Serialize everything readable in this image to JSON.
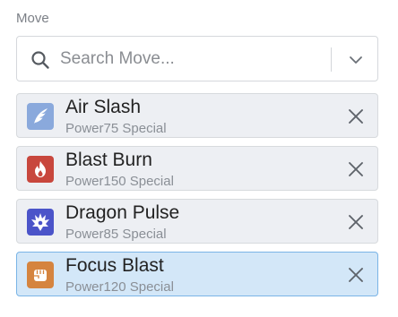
{
  "field": {
    "label": "Move",
    "search": {
      "placeholder": "Search Move..."
    }
  },
  "moves": [
    {
      "name": "Air Slash",
      "power_label": "Power",
      "power": "75",
      "category": "Special",
      "type_icon": "wing-icon",
      "type_color": "#8aa9dc",
      "selected": false
    },
    {
      "name": "Blast Burn",
      "power_label": "Power",
      "power": "150",
      "category": "Special",
      "type_icon": "flame-icon",
      "type_color": "#c8473d",
      "selected": false
    },
    {
      "name": "Dragon Pulse",
      "power_label": "Power",
      "power": "85",
      "category": "Special",
      "type_icon": "dragon-icon",
      "type_color": "#4b54c9",
      "selected": false
    },
    {
      "name": "Focus Blast",
      "power_label": "Power",
      "power": "120",
      "category": "Special",
      "type_icon": "fist-icon",
      "type_color": "#d5843f",
      "selected": true
    }
  ]
}
